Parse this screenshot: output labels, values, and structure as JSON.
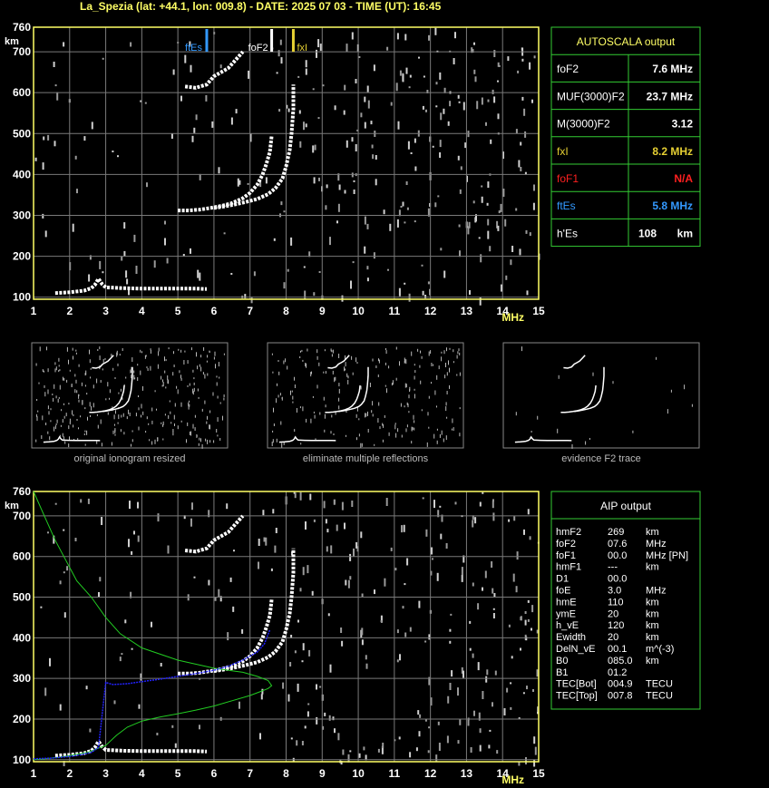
{
  "header": {
    "title": "La_Spezia (lat: +44.1, lon: 009.8) - DATE: 2025 07 03 - TIME (UT): 16:45"
  },
  "colors": {
    "axes": "#ffff66",
    "grid": "#7a7a7a",
    "table_border": "#33cc33",
    "fxI": "#e6d033",
    "foF1": "#ff2020",
    "ftEs": "#3399ff",
    "profile": "#22cc22",
    "aip_trace": "#2222ff"
  },
  "autoscala": {
    "title": "AUTOSCALA output",
    "rows": [
      {
        "label": "foF2",
        "value": "7.6 MHz",
        "color": "#ffffff"
      },
      {
        "label": "MUF(3000)F2",
        "value": "23.7 MHz",
        "color": "#ffffff"
      },
      {
        "label": "M(3000)F2",
        "value": "3.12",
        "color": "#ffffff"
      },
      {
        "label": "fxI",
        "value": "8.2 MHz",
        "color": "#e6d033"
      },
      {
        "label": "foF1",
        "value": "N/A",
        "color": "#ff2020"
      },
      {
        "label": "ftEs",
        "value": "5.8 MHz",
        "color": "#3399ff"
      },
      {
        "label": "h'Es",
        "value": "108",
        "unit": "km",
        "color": "#ffffff"
      }
    ]
  },
  "aip": {
    "title": "AIP output",
    "rows": [
      {
        "name": "hmF2",
        "value": "269",
        "unit": "km"
      },
      {
        "name": "foF2",
        "value": "07.6",
        "unit": "MHz"
      },
      {
        "name": "foF1",
        "value": "00.0",
        "unit": "MHz   [PN]"
      },
      {
        "name": "hmF1",
        "value": "---",
        "unit": "km"
      },
      {
        "name": "D1",
        "value": "00.0",
        "unit": ""
      },
      {
        "name": "foE",
        "value": "3.0",
        "unit": "MHz"
      },
      {
        "name": "hmE",
        "value": "110",
        "unit": "km"
      },
      {
        "name": "ymE",
        "value": "20",
        "unit": "km"
      },
      {
        "name": "h_vE",
        "value": "120",
        "unit": "km"
      },
      {
        "name": "Ewidth",
        "value": "20",
        "unit": "km"
      },
      {
        "name": "DelN_vE",
        "value": "00.1",
        "unit": "m^(-3)"
      },
      {
        "name": "B0",
        "value": "085.0",
        "unit": "km"
      },
      {
        "name": "B1",
        "value": "01.2",
        "unit": ""
      },
      {
        "name": "TEC[Bot]",
        "value": "004.9",
        "unit": "TECU"
      },
      {
        "name": "TEC[Top]",
        "value": "007.8",
        "unit": "TECU"
      }
    ]
  },
  "thumbnails": [
    {
      "caption": "original ionogram resized"
    },
    {
      "caption": "eliminate multiple reflections"
    },
    {
      "caption": "evidence F2 trace"
    }
  ],
  "chart_data": [
    {
      "type": "scatter",
      "title": "",
      "xlabel": "MHz",
      "ylabel": "km",
      "xlim": [
        1,
        15
      ],
      "ylim": [
        95,
        760
      ],
      "x_ticks": [
        1,
        2,
        3,
        4,
        5,
        6,
        7,
        8,
        9,
        10,
        11,
        12,
        13,
        14,
        15
      ],
      "y_ticks": [
        100,
        200,
        300,
        400,
        500,
        600,
        700,
        760
      ],
      "grid": true,
      "markers": [
        {
          "name": "ftEs",
          "x": 5.8,
          "color": "#3399ff"
        },
        {
          "name": "foF2",
          "x": 7.6,
          "color": "#ffffff"
        },
        {
          "name": "fxI",
          "x": 8.2,
          "color": "#e6d033"
        }
      ],
      "traces": [
        {
          "name": "Es trace",
          "x": [
            1.6,
            2.0,
            2.4,
            2.6,
            2.7,
            2.8,
            2.9,
            3.0,
            3.5,
            4.0,
            4.5,
            5.0,
            5.5,
            5.8
          ],
          "y": [
            110,
            112,
            116,
            122,
            130,
            145,
            132,
            124,
            122,
            121,
            121,
            121,
            121,
            120
          ]
        },
        {
          "name": "F2 o-trace",
          "x": [
            5.0,
            5.3,
            5.6,
            5.9,
            6.2,
            6.5,
            6.8,
            7.0,
            7.2,
            7.35,
            7.45,
            7.55,
            7.6
          ],
          "y": [
            312,
            312,
            314,
            318,
            323,
            330,
            342,
            355,
            375,
            400,
            425,
            455,
            495
          ]
        },
        {
          "name": "F2 x-trace",
          "x": [
            6.0,
            6.3,
            6.6,
            6.9,
            7.2,
            7.5,
            7.7,
            7.9,
            8.0,
            8.1,
            8.15,
            8.2,
            8.2
          ],
          "y": [
            318,
            322,
            327,
            333,
            340,
            352,
            366,
            390,
            420,
            460,
            500,
            560,
            620
          ]
        },
        {
          "name": "second hop",
          "x": [
            5.2,
            5.5,
            5.8,
            6.0,
            6.2,
            6.4,
            6.6,
            6.8
          ],
          "y": [
            615,
            612,
            620,
            640,
            650,
            660,
            680,
            700
          ]
        }
      ]
    },
    {
      "type": "scatter",
      "title": "",
      "xlabel": "MHz",
      "ylabel": "km",
      "xlim": [
        1,
        15
      ],
      "ylim": [
        95,
        760
      ],
      "x_ticks": [
        1,
        2,
        3,
        4,
        5,
        6,
        7,
        8,
        9,
        10,
        11,
        12,
        13,
        14,
        15
      ],
      "y_ticks": [
        100,
        200,
        300,
        400,
        500,
        600,
        700,
        760
      ],
      "grid": true,
      "series": [
        {
          "name": "electron density profile",
          "x": [
            1.0,
            1.3,
            1.7,
            2.0,
            2.5,
            3.0,
            3.3,
            3.6,
            4.0,
            4.5,
            5.0,
            5.5,
            6.0,
            6.5,
            7.0,
            7.3,
            7.5,
            7.6,
            7.5,
            7.2,
            6.8,
            6.0,
            5.0,
            4.0,
            3.4,
            3.0,
            2.6,
            2.2,
            1.9,
            1.6,
            1.3,
            1.0
          ],
          "y": [
            100,
            102,
            106,
            110,
            118,
            135,
            160,
            180,
            195,
            205,
            213,
            222,
            232,
            245,
            258,
            268,
            275,
            282,
            295,
            305,
            315,
            325,
            345,
            375,
            410,
            450,
            500,
            540,
            590,
            640,
            700,
            760
          ]
        },
        {
          "name": "AIP virtual height",
          "x": [
            1.0,
            1.5,
            2.0,
            2.3,
            2.6,
            2.8,
            3.0,
            3.2,
            3.6,
            4.0,
            4.5,
            5.0,
            5.5,
            6.0,
            6.4,
            6.8,
            7.2,
            7.4,
            7.55
          ],
          "y": [
            102,
            104,
            108,
            112,
            118,
            130,
            290,
            285,
            287,
            292,
            298,
            305,
            312,
            320,
            330,
            345,
            365,
            385,
            420
          ]
        }
      ]
    }
  ]
}
